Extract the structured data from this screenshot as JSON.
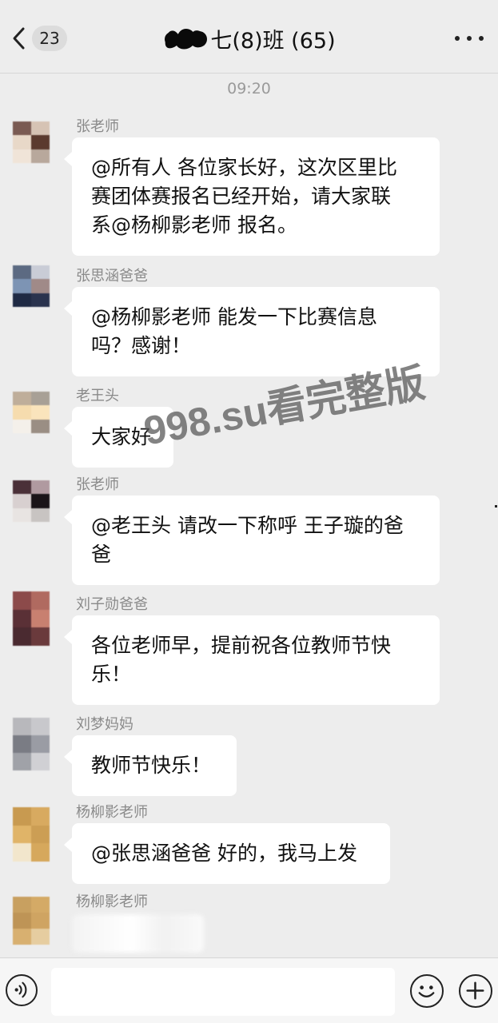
{
  "header": {
    "unread_count": "23",
    "title": "七(8)班 (65)",
    "back_icon": "chevron-left-icon",
    "more_icon": "ellipsis-icon"
  },
  "time_label": "09:20",
  "messages": [
    {
      "sender": "张老师",
      "text": "@所有人 各位家长好，这次区里比\n赛团体赛报名已经开始，请大家联\n系@杨柳影老师 报名。"
    },
    {
      "sender": "张思涵爸爸",
      "text": "@杨柳影老师 能发一下比赛信息\n吗？感谢！"
    },
    {
      "sender": "老王头",
      "text": "大家好"
    },
    {
      "sender": "张老师",
      "text": "@老王头 请改一下称呼 王子璇的爸\n爸"
    },
    {
      "sender": "刘子勋爸爸",
      "text": "各位老师早，提前祝各位教师节快\n乐！"
    },
    {
      "sender": "刘梦妈妈",
      "text": "教师节快乐！"
    },
    {
      "sender": "杨柳影老师",
      "text": "@张思涵爸爸 好的，我马上发"
    },
    {
      "sender": "杨柳影老师"
    }
  ],
  "watermark": "998.su看完整版",
  "input_bar": {
    "voice_icon": "voice-icon",
    "emoji_icon": "emoji-icon",
    "plus_icon": "plus-icon",
    "input_value": ""
  },
  "colors": {
    "background": "#ededed",
    "bubble": "#ffffff",
    "sender_text": "#8a8a8a",
    "time_text": "#9a9a9a"
  }
}
